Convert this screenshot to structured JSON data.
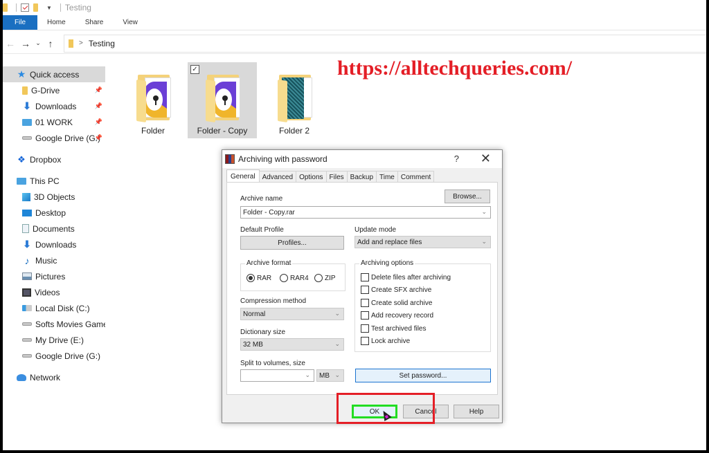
{
  "explorer": {
    "window_title": "Testing",
    "ribbon_tabs": [
      "File",
      "Home",
      "Share",
      "View"
    ],
    "address": {
      "path": [
        "Testing"
      ]
    },
    "sidebar": {
      "quick_access": {
        "label": "Quick access",
        "items": [
          {
            "label": "G-Drive",
            "icon": "folder-icon",
            "pinned": true
          },
          {
            "label": "Downloads",
            "icon": "download-icon",
            "pinned": true
          },
          {
            "label": "01 WORK",
            "icon": "network-folder-icon",
            "pinned": true
          },
          {
            "label": "Google Drive (G:)",
            "icon": "drive-icon",
            "pinned": true
          }
        ]
      },
      "dropbox": {
        "label": "Dropbox"
      },
      "this_pc": {
        "label": "This PC",
        "items": [
          {
            "label": "3D Objects",
            "icon": "3d-objects-icon"
          },
          {
            "label": "Desktop",
            "icon": "desktop-icon"
          },
          {
            "label": "Documents",
            "icon": "documents-icon"
          },
          {
            "label": "Downloads",
            "icon": "download-icon"
          },
          {
            "label": "Music",
            "icon": "music-icon"
          },
          {
            "label": "Pictures",
            "icon": "pictures-icon"
          },
          {
            "label": "Videos",
            "icon": "videos-icon"
          },
          {
            "label": "Local Disk (C:)",
            "icon": "local-disk-icon"
          },
          {
            "label": "Softs Movies Games",
            "icon": "drive-icon"
          },
          {
            "label": "My Drive (E:)",
            "icon": "drive-icon"
          },
          {
            "label": "Google Drive (G:)",
            "icon": "drive-icon"
          }
        ]
      },
      "network": {
        "label": "Network"
      }
    },
    "files": [
      {
        "name": "Folder",
        "selected": false
      },
      {
        "name": "Folder - Copy",
        "selected": true
      },
      {
        "name": "Folder 2",
        "selected": false
      }
    ]
  },
  "watermark": "https://alltechqueries.com/",
  "dialog": {
    "title": "Archiving with password",
    "help": "?",
    "close": "✕",
    "tabs": [
      "General",
      "Advanced",
      "Options",
      "Files",
      "Backup",
      "Time",
      "Comment"
    ],
    "active_tab": "General",
    "archive_name_label": "Archive name",
    "archive_name_value": "Folder - Copy.rar",
    "browse_button": "Browse...",
    "default_profile_label": "Default Profile",
    "profiles_button": "Profiles...",
    "update_mode_label": "Update mode",
    "update_mode_value": "Add and replace files",
    "archive_format": {
      "title": "Archive format",
      "options": [
        "RAR",
        "RAR4",
        "ZIP"
      ],
      "selected": "RAR"
    },
    "compression_method_label": "Compression method",
    "compression_method_value": "Normal",
    "dictionary_size_label": "Dictionary size",
    "dictionary_size_value": "32 MB",
    "split_label": "Split to volumes, size",
    "split_value": "",
    "split_unit": "MB",
    "archiving_options": {
      "title": "Archiving options",
      "items": [
        {
          "label": "Delete files after archiving",
          "checked": false
        },
        {
          "label": "Create SFX archive",
          "checked": false
        },
        {
          "label": "Create solid archive",
          "checked": false
        },
        {
          "label": "Add recovery record",
          "checked": false
        },
        {
          "label": "Test archived files",
          "checked": false
        },
        {
          "label": "Lock archive",
          "checked": false
        }
      ]
    },
    "set_password_button": "Set password...",
    "ok_button": "OK",
    "cancel_button": "Cancel",
    "help_button": "Help"
  },
  "colors": {
    "watermark": "#e41e26",
    "highlight_box": "#e41e26",
    "ok_highlight": "#22dd22",
    "file_tab": "#1a6fc1"
  }
}
